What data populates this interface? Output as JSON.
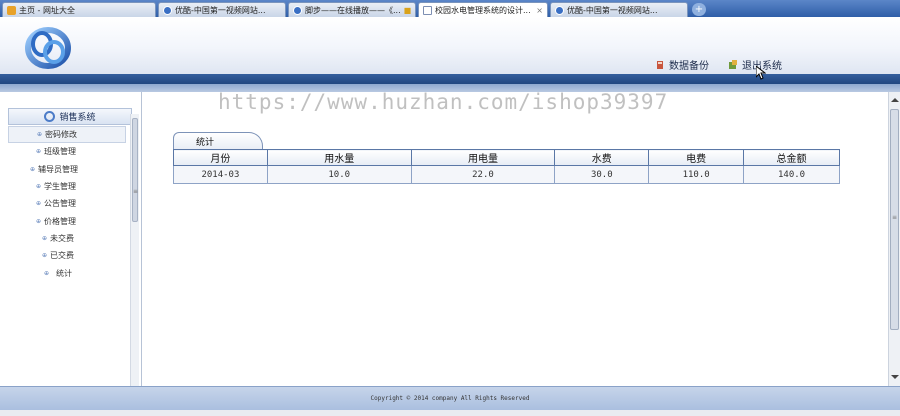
{
  "browser": {
    "tabs": [
      {
        "label": "主页 - 网址大全",
        "icon": "home-icon",
        "active": false
      },
      {
        "label": "优酷-中国第一视频网站...",
        "icon": "video-icon",
        "active": false
      },
      {
        "label": "脚步——在线播放——《...",
        "icon": "video-icon",
        "active": false
      },
      {
        "label": "校园水电管理系统的设计...",
        "icon": "page-icon",
        "active": true
      },
      {
        "label": "优酷-中国第一视频网站...",
        "icon": "video-icon",
        "active": false
      }
    ],
    "close_glyph": "×",
    "new_tab_glyph": "+"
  },
  "header": {
    "backup_label": "数据备份",
    "logout_label": "退出系统"
  },
  "watermark": "https://www.huzhan.com/ishop39397",
  "sidebar": {
    "title": "销售系统",
    "items": [
      {
        "label": "密码修改"
      },
      {
        "label": "班级管理"
      },
      {
        "label": "辅导员管理"
      },
      {
        "label": "学生管理"
      },
      {
        "label": "公告管理"
      },
      {
        "label": "价格管理"
      },
      {
        "label": "未交费"
      },
      {
        "label": "已交费"
      },
      {
        "label": "统计"
      }
    ]
  },
  "main": {
    "tab_label": "统计",
    "table": {
      "columns": [
        "月份",
        "用水量",
        "用电量",
        "水费",
        "电费",
        "总金额"
      ],
      "rows": [
        [
          "2014-03",
          "10.0",
          "22.0",
          "30.0",
          "110.0",
          "140.0"
        ]
      ]
    }
  },
  "footer": {
    "copyright": "Copyright © 2014 company All Rights Reserved"
  },
  "colors": {
    "header_bar": "#2a5290",
    "footer_bg": "#b8c9e4",
    "table_border": "#5a77a6"
  }
}
